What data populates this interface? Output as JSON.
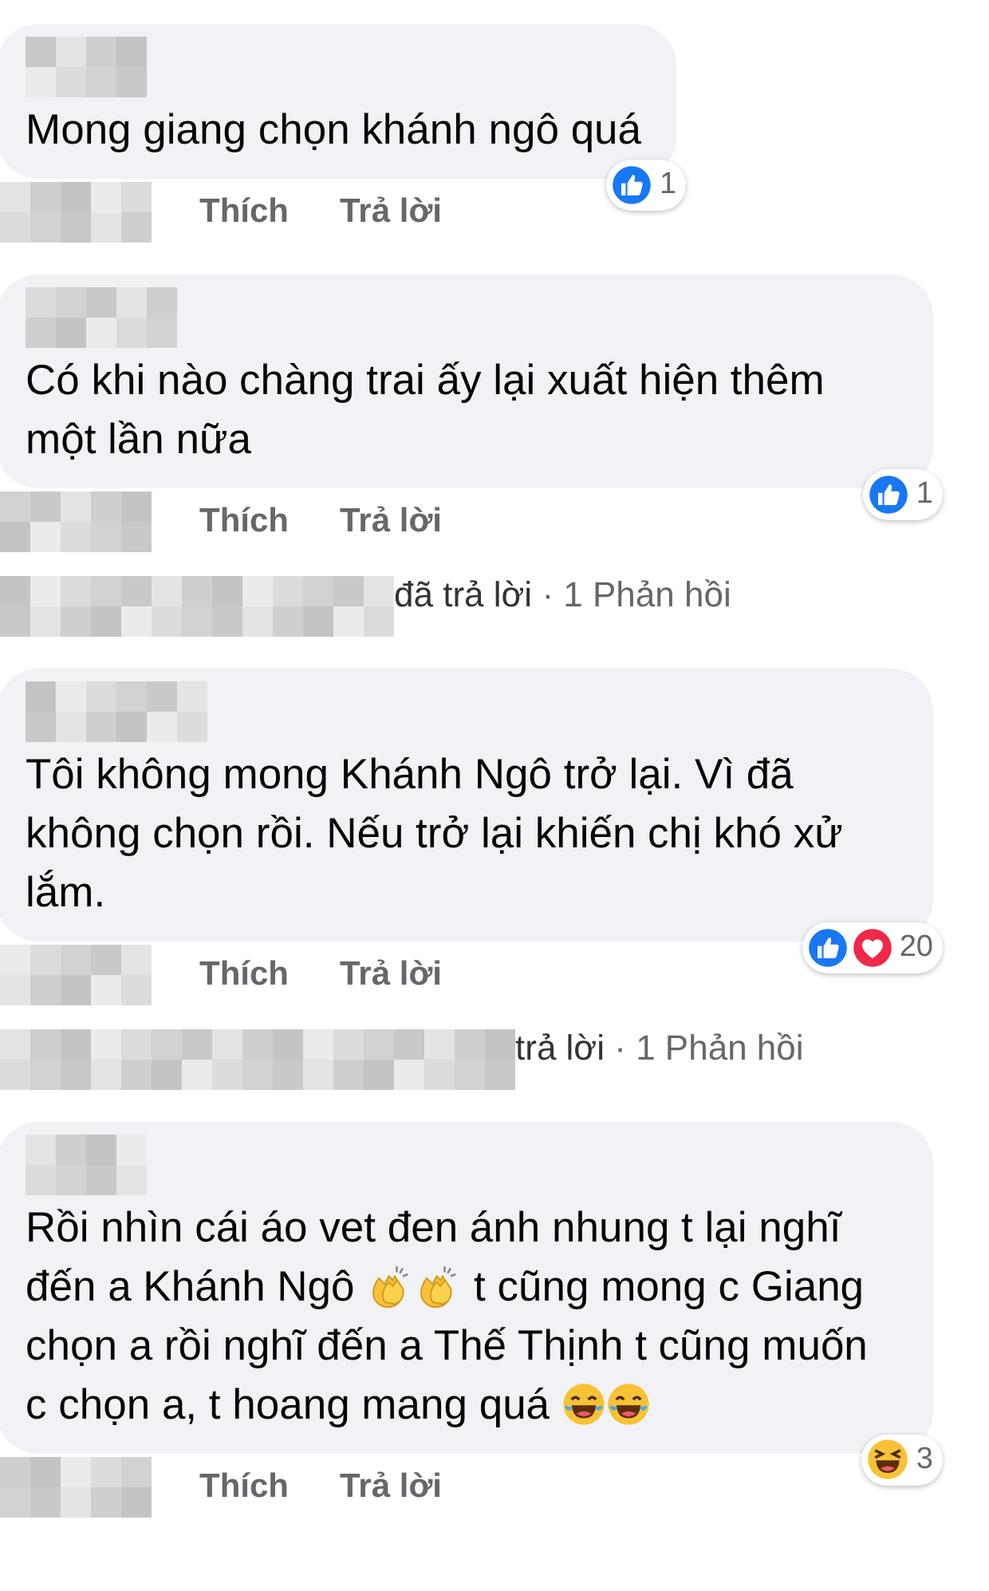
{
  "comments": [
    {
      "body": [
        {
          "kind": "text",
          "text": "Mong giang chọn khánh ngô quá"
        }
      ],
      "reactions": {
        "kinds": [
          {
            "kind": "like"
          }
        ],
        "count": "1"
      },
      "actions": [
        "Thích",
        "Trả lời"
      ]
    },
    {
      "body": [
        {
          "kind": "text",
          "text": "Có khi nào chàng trai ấy lại xuất hiện thêm một lần nữa"
        }
      ],
      "reactions": {
        "kinds": [
          {
            "kind": "like"
          }
        ],
        "count": "1"
      },
      "actions": [
        "Thích",
        "Trả lời"
      ],
      "replies": {
        "text": "đã trả lời",
        "separator": "·",
        "count": "1 Phản hồi"
      }
    },
    {
      "body": [
        {
          "kind": "text",
          "text": "Tôi không mong Khánh Ngô trở lại. Vì đã không chọn rồi. Nếu trở lại khiến chị khó xử lắm."
        }
      ],
      "reactions": {
        "kinds": [
          {
            "kind": "like"
          },
          {
            "kind": "love"
          }
        ],
        "count": "20"
      },
      "actions": [
        "Thích",
        "Trả lời"
      ],
      "replies": {
        "text": "trả lời",
        "separator": "·",
        "count": "1 Phản hồi"
      }
    },
    {
      "body": [
        {
          "kind": "text",
          "text": "Rồi nhìn cái áo vet đen ánh nhung t lại nghĩ đến a Khánh Ngô "
        },
        {
          "kind": "clap"
        },
        {
          "kind": "clap"
        },
        {
          "kind": "text",
          "text": " t cũng mong c Giang chọn a rồi nghĩ đến a Thế Thịnh t cũng muốn c chọn a, t hoang mang quá "
        },
        {
          "kind": "laugh"
        },
        {
          "kind": "laugh"
        }
      ],
      "reactions": {
        "kinds": [
          {
            "kind": "laugh_squint"
          }
        ],
        "count": "3"
      },
      "actions": [
        "Thích",
        "Trả lời"
      ]
    }
  ]
}
